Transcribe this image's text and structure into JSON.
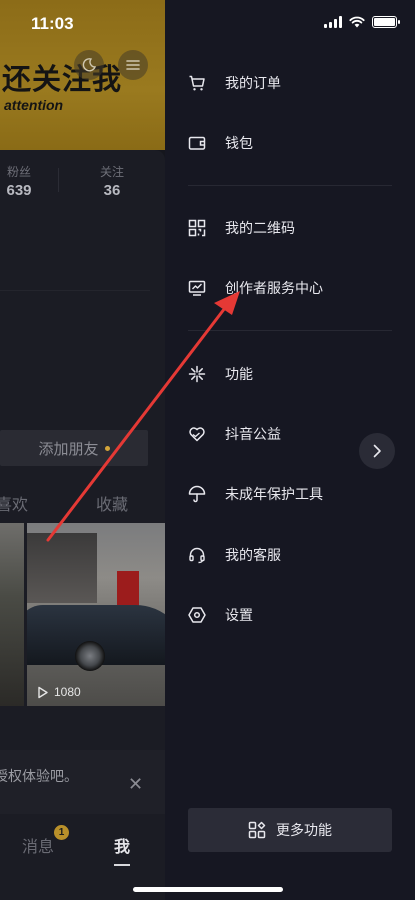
{
  "status_bar": {
    "time": "11:03"
  },
  "profile": {
    "cover_title": "还关注我",
    "cover_subtitle": "attention",
    "stats": [
      {
        "label": "粉丝",
        "value": "639"
      },
      {
        "label": "关注",
        "value": "36"
      }
    ],
    "add_friend_label": "添加朋友",
    "tabs": [
      "喜欢",
      "收藏"
    ],
    "video_play_count": "1080",
    "tip_text": "授权体验吧。"
  },
  "bottom_nav": {
    "messages_label": "消息",
    "messages_badge": "1",
    "me_label": "我"
  },
  "drawer": {
    "menu_group_1": [
      {
        "label": "我的订单",
        "icon": "cart-icon"
      },
      {
        "label": "钱包",
        "icon": "wallet-icon"
      }
    ],
    "menu_group_2": [
      {
        "label": "我的二维码",
        "icon": "qrcode-icon"
      },
      {
        "label": "创作者服务中心",
        "icon": "chart-monitor-icon"
      }
    ],
    "menu_group_3": [
      {
        "label": "功能",
        "icon": "sparkle-icon"
      },
      {
        "label": "抖音公益",
        "icon": "heart-hand-icon"
      },
      {
        "label": "未成年保护工具",
        "icon": "umbrella-icon"
      },
      {
        "label": "我的客服",
        "icon": "headset-icon"
      },
      {
        "label": "设置",
        "icon": "hexagon-settings-icon"
      }
    ],
    "more_button_label": "更多功能"
  },
  "colors": {
    "drawer_bg": "#161722",
    "cover_gold": "#9a7a1f",
    "annotation_arrow": "#e53935",
    "badge": "#b9902a"
  }
}
